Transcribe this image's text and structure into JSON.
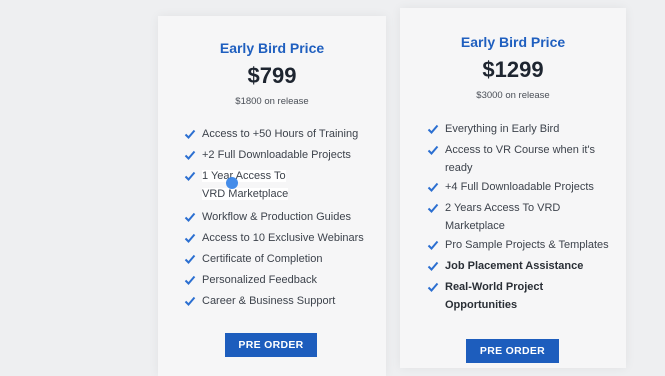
{
  "cards": [
    {
      "title": "Early Bird Price",
      "price": "$799",
      "release_note": "$1800 on release",
      "features": [
        "Access to +50 Hours of Training",
        "+2 Full Downloadable Projects",
        "1 Year Access To VRD Marketplace",
        "Workflow & Production Guides",
        "Access to 10 Exclusive Webinars",
        "Certificate of Completion",
        "Personalized Feedback",
        "Career & Business Support"
      ],
      "button_label": "PRE ORDER"
    },
    {
      "title": "Early Bird Price",
      "price": "$1299",
      "release_note": "$3000 on release",
      "features": [
        "Everything in Early Bird",
        "Access to VR Course when it's ready",
        "+4 Full Downloadable Projects",
        "2 Years Access To VRD Marketplace",
        "Pro Sample Projects & Templates",
        "Job Placement Assistance",
        "Real-World Project Opportunities"
      ],
      "button_label": "PRE ORDER"
    }
  ],
  "colors": {
    "accent": "#1f5fbf",
    "button": "#1d5dbd",
    "check": "#2b6fd1",
    "background": "#eeeff1",
    "card": "#f6f6f7"
  },
  "icons": {
    "feature_check": "check-icon",
    "cursor": "cursor-dot"
  }
}
